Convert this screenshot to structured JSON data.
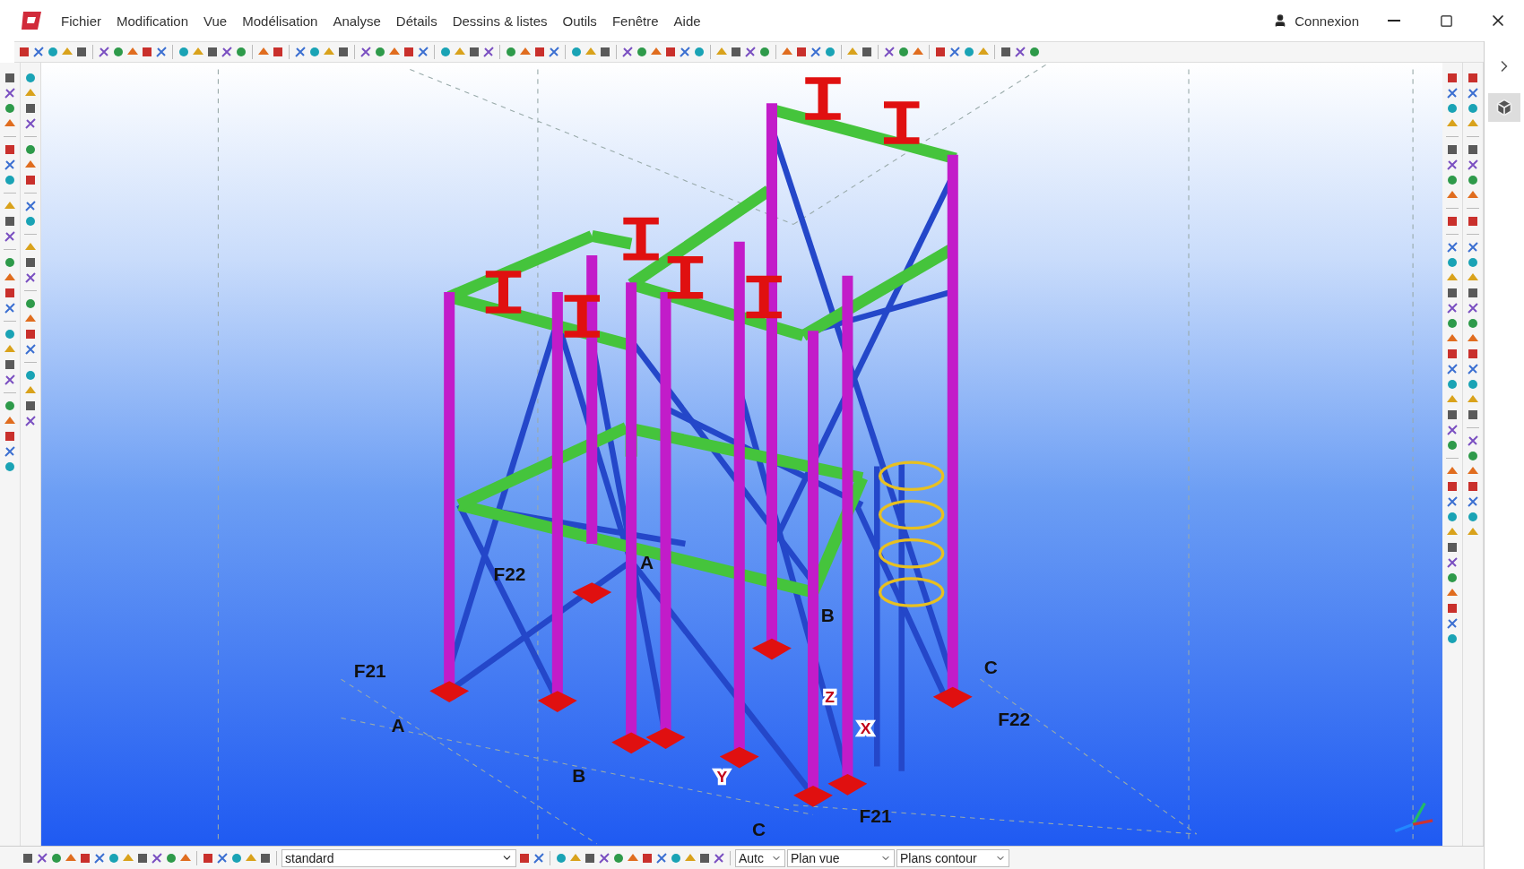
{
  "window": {
    "menu": [
      "Fichier",
      "Modification",
      "Vue",
      "Modélisation",
      "Analyse",
      "Détails",
      "Dessins & listes",
      "Outils",
      "Fenêtre",
      "Aide"
    ],
    "account": "Connexion"
  },
  "viewport": {
    "grid_labels": [
      "F22",
      "A",
      "B",
      "F21",
      "A",
      "B",
      "C",
      "F22",
      "F21",
      "C"
    ],
    "axis_labels": [
      "Z",
      "Y",
      "X"
    ]
  },
  "bottom_bar": {
    "view_select": "standard",
    "dropdowns": [
      "Autc",
      "Plan vue",
      "Plans contour"
    ]
  }
}
